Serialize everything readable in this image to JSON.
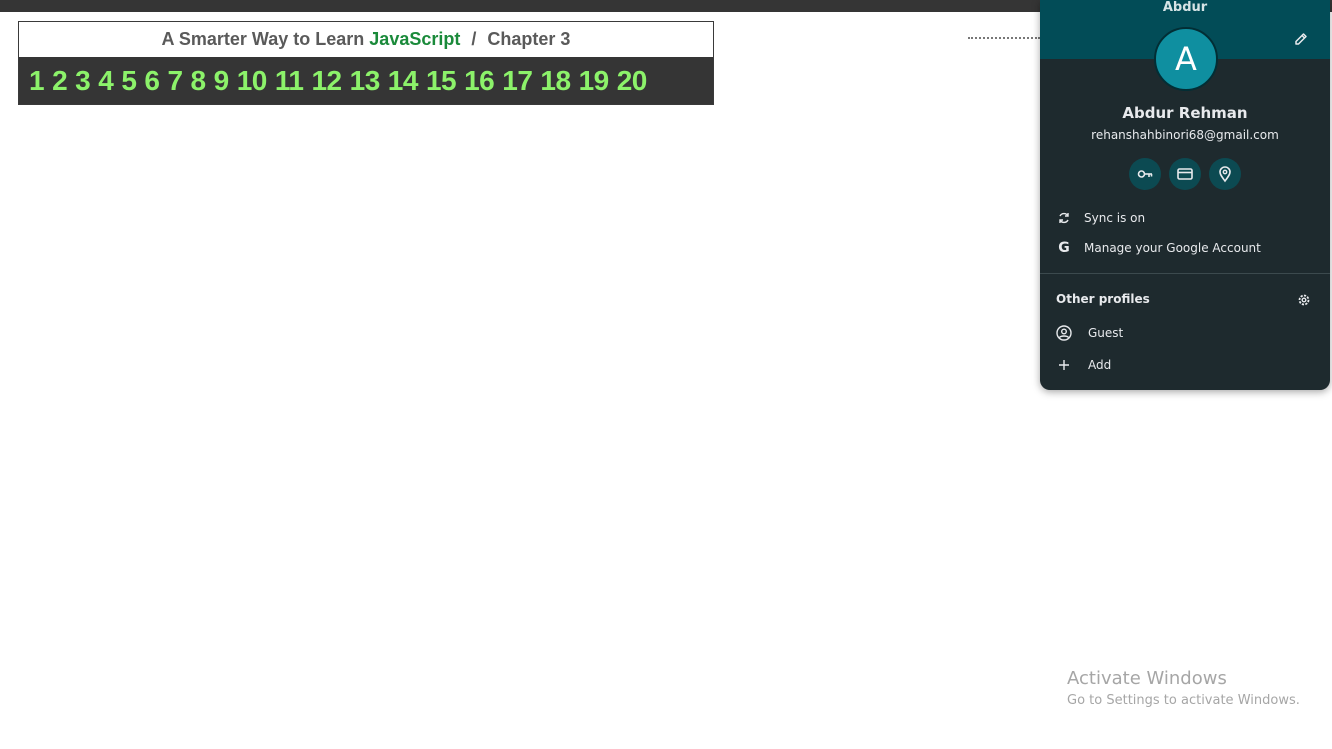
{
  "book": {
    "title_prefix": "A Smarter Way to Learn",
    "title_accent": "JavaScript",
    "separator": "/",
    "chapter": "Chapter 3",
    "accent_color": "#1a8a3a",
    "chapter_links": [
      "1",
      "2",
      "3",
      "4",
      "5",
      "6",
      "7",
      "8",
      "9",
      "10",
      "11",
      "12",
      "13",
      "14",
      "15",
      "16",
      "17",
      "18",
      "19",
      "20"
    ],
    "link_color": "#8cf26a"
  },
  "profile": {
    "banner_name": "Abdur",
    "avatar_letter": "A",
    "full_name": "Abdur Rehman",
    "email": "rehanshahbinori68@gmail.com",
    "quick_icons": [
      "key-icon",
      "credit-card-icon",
      "location-pin-icon"
    ],
    "sync_label": "Sync is on",
    "manage_label": "Manage your Google Account",
    "other_profiles_title": "Other profiles",
    "guest_label": "Guest",
    "add_label": "Add",
    "banner_color": "#024c57",
    "avatar_color": "#0f8fa0"
  },
  "watermark": {
    "line1": "Activate Windows",
    "line2": "Go to Settings to activate Windows."
  }
}
